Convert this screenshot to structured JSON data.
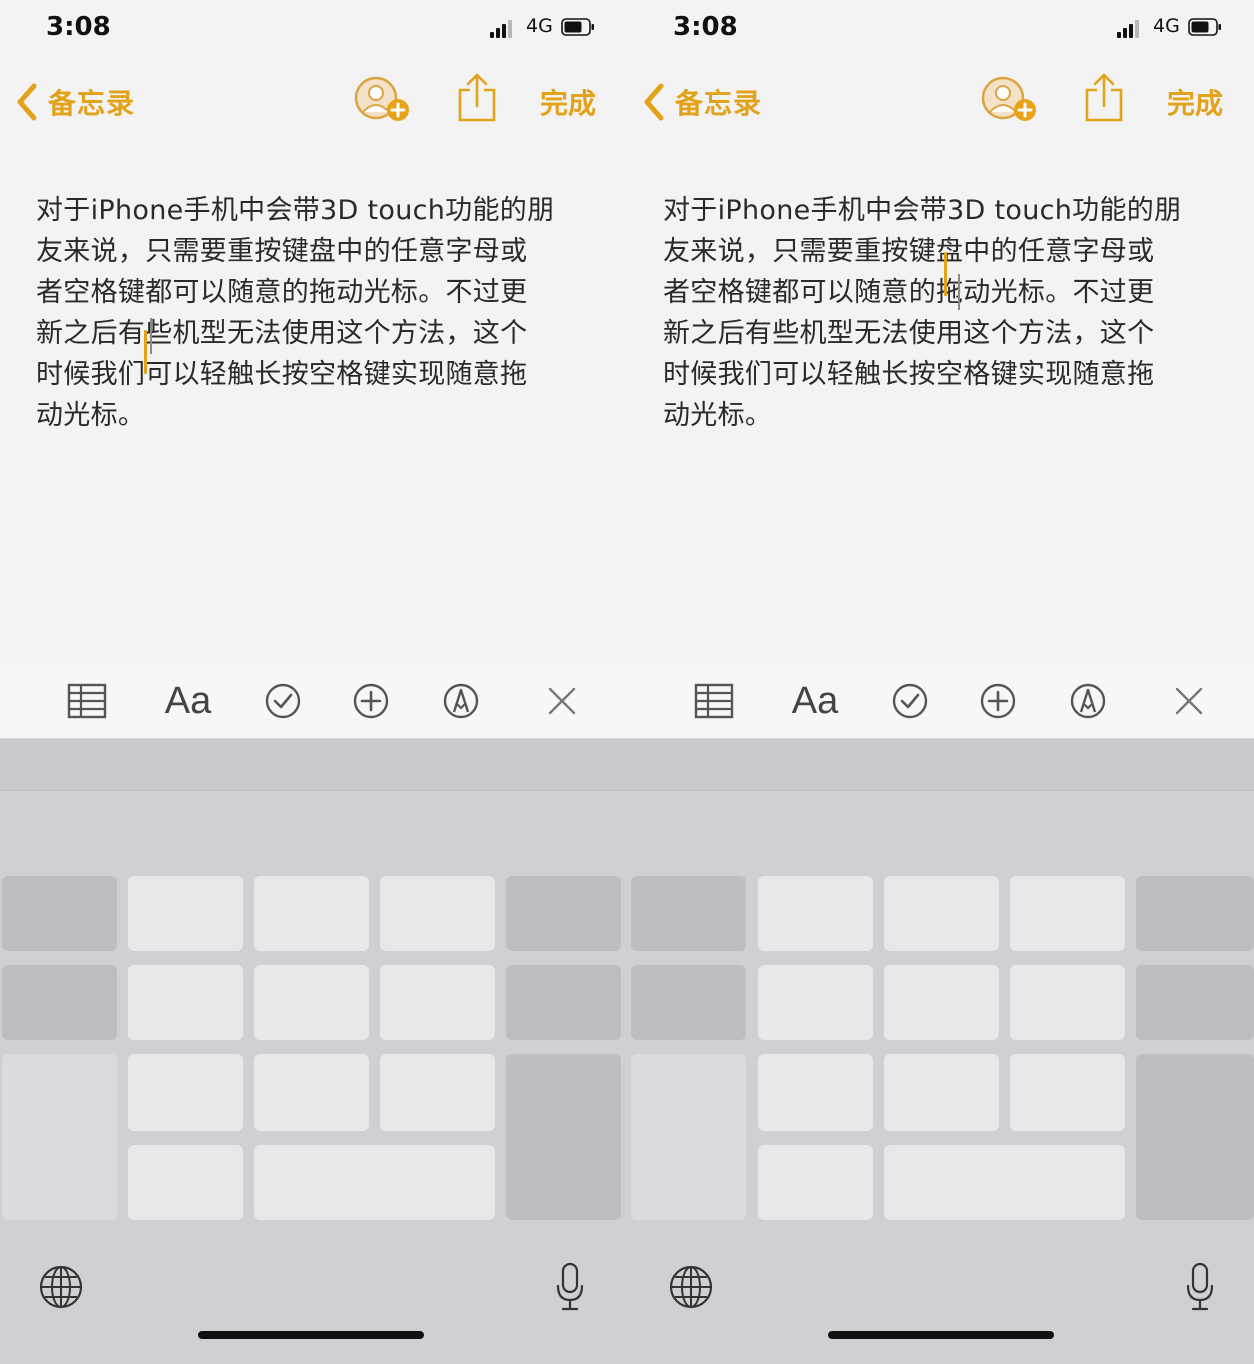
{
  "screens": [
    {
      "status": {
        "time": "3:08",
        "network": "4G"
      },
      "nav": {
        "back_label": "备忘录",
        "done_label": "完成"
      },
      "note_text": "对于iPhone手机中会带3D touch功能的朋\n友来说，只需要重按键盘中的任意字母或\n者空格键都可以随意的拖动光标。不过更\n新之后有些机型无法使用这个方法，这个\n时候我们可以轻触长按空格键实现随意拖\n动光标。",
      "toolbar": {
        "format_label": "Aa"
      }
    },
    {
      "status": {
        "time": "3:08",
        "network": "4G"
      },
      "nav": {
        "back_label": "备忘录",
        "done_label": "完成"
      },
      "note_text": "对于iPhone手机中会带3D touch功能的朋\n友来说，只需要重按键盘中的任意字母或\n者空格键都可以随意的拖动光标。不过更\n新之后有些机型无法使用这个方法，这个\n时候我们可以轻触长按空格键实现随意拖\n动光标。",
      "toolbar": {
        "format_label": "Aa"
      }
    }
  ],
  "colors": {
    "accent": "#e2a21a",
    "background": "#f3f3f3",
    "keyboard": "#cfcfd4"
  },
  "icons": [
    "chevron-left-icon",
    "add-person-icon",
    "share-icon",
    "table-icon",
    "checklist-icon",
    "add-circle-icon",
    "markup-pen-icon",
    "close-icon",
    "globe-icon",
    "microphone-icon"
  ]
}
